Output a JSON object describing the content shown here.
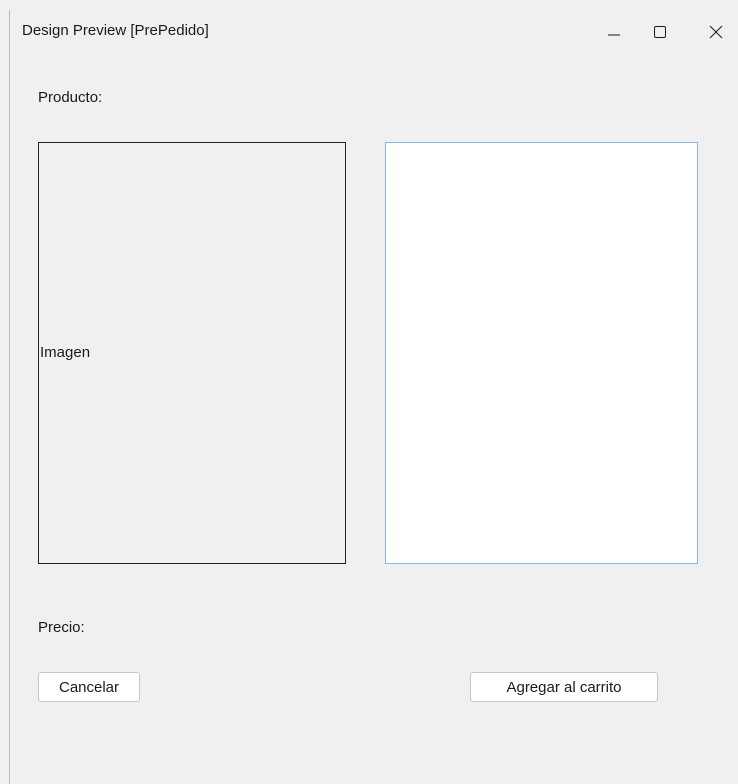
{
  "window": {
    "title": "Design Preview [PrePedido]"
  },
  "title_controls": {
    "minimize": "minimize-icon",
    "maximize": "maximize-icon",
    "close": "close-icon"
  },
  "form": {
    "producto_label": "Producto:",
    "imagen_label": "Imagen",
    "description_value": "",
    "precio_label": "Precio:",
    "cancel_label": "Cancelar",
    "add_label": "Agregar al carrito"
  }
}
